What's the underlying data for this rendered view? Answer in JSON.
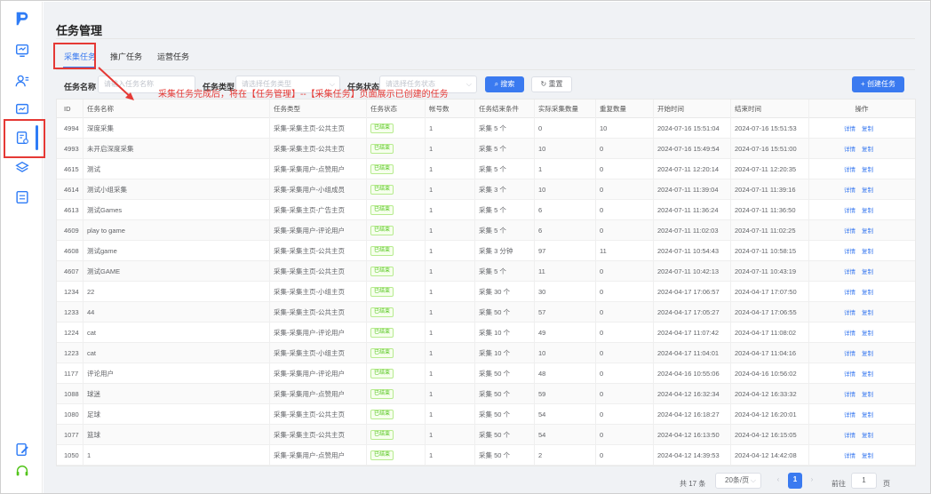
{
  "page_title": "任务管理",
  "tabs": [
    "采集任务",
    "推广任务",
    "运营任务"
  ],
  "filters": {
    "name_label": "任务名称",
    "name_placeholder": "请输入任务名称",
    "type_label": "任务类型",
    "type_placeholder": "请选择任务类型",
    "status_label": "任务状态",
    "status_placeholder": "请选择任务状态",
    "search_label": "搜索",
    "reset_label": "重置",
    "create_label": "+ 创建任务"
  },
  "annotation": "采集任务完成后，将在【任务管理】--【采集任务】页面展示已创建的任务",
  "columns": [
    "ID",
    "任务名称",
    "任务类型",
    "任务状态",
    "帐号数",
    "任务结束条件",
    "实际采集数量",
    "重复数量",
    "开始时间",
    "结束时间",
    "操作"
  ],
  "row_actions": [
    "详情",
    "复制"
  ],
  "rows": [
    [
      "4994",
      "深度采集",
      "采集-采集主页-公共主页",
      "已结束",
      "1",
      "采集 5 个",
      "0",
      "10",
      "2024-07-16 15:51:04",
      "2024-07-16 15:51:53"
    ],
    [
      "4993",
      "未开启深度采集",
      "采集-采集主页-公共主页",
      "已结束",
      "1",
      "采集 5 个",
      "10",
      "0",
      "2024-07-16 15:49:54",
      "2024-07-16 15:51:00"
    ],
    [
      "4615",
      "测试",
      "采集-采集用户-点赞用户",
      "已结束",
      "1",
      "采集 5 个",
      "1",
      "0",
      "2024-07-11 12:20:14",
      "2024-07-11 12:20:35"
    ],
    [
      "4614",
      "测试小组采集",
      "采集-采集用户-小组成员",
      "已结束",
      "1",
      "采集 3 个",
      "10",
      "0",
      "2024-07-11 11:39:04",
      "2024-07-11 11:39:16"
    ],
    [
      "4613",
      "测试Games",
      "采集-采集主页-广告主页",
      "已结束",
      "1",
      "采集 5 个",
      "6",
      "0",
      "2024-07-11 11:36:24",
      "2024-07-11 11:36:50"
    ],
    [
      "4609",
      "play to game",
      "采集-采集用户-评论用户",
      "已结束",
      "1",
      "采集 5 个",
      "6",
      "0",
      "2024-07-11 11:02:03",
      "2024-07-11 11:02:25"
    ],
    [
      "4608",
      "测试game",
      "采集-采集主页-公共主页",
      "已结束",
      "1",
      "采集 3 分钟",
      "97",
      "11",
      "2024-07-11 10:54:43",
      "2024-07-11 10:58:15"
    ],
    [
      "4607",
      "测试GAME",
      "采集-采集主页-公共主页",
      "已结束",
      "1",
      "采集 5 个",
      "11",
      "0",
      "2024-07-11 10:42:13",
      "2024-07-11 10:43:19"
    ],
    [
      "1234",
      "22",
      "采集-采集主页-小组主页",
      "已结束",
      "1",
      "采集 30 个",
      "30",
      "0",
      "2024-04-17 17:06:57",
      "2024-04-17 17:07:50"
    ],
    [
      "1233",
      "44",
      "采集-采集主页-公共主页",
      "已结束",
      "1",
      "采集 50 个",
      "57",
      "0",
      "2024-04-17 17:05:27",
      "2024-04-17 17:06:55"
    ],
    [
      "1224",
      "cat",
      "采集-采集用户-评论用户",
      "已结束",
      "1",
      "采集 10 个",
      "49",
      "0",
      "2024-04-17 11:07:42",
      "2024-04-17 11:08:02"
    ],
    [
      "1223",
      "cat",
      "采集-采集主页-小组主页",
      "已结束",
      "1",
      "采集 10 个",
      "10",
      "0",
      "2024-04-17 11:04:01",
      "2024-04-17 11:04:16"
    ],
    [
      "1177",
      "评论用户",
      "采集-采集用户-评论用户",
      "已结束",
      "1",
      "采集 50 个",
      "48",
      "0",
      "2024-04-16 10:55:06",
      "2024-04-16 10:56:02"
    ],
    [
      "1088",
      "球迷",
      "采集-采集用户-点赞用户",
      "已结束",
      "1",
      "采集 50 个",
      "59",
      "0",
      "2024-04-12 16:32:34",
      "2024-04-12 16:33:32"
    ],
    [
      "1080",
      "足球",
      "采集-采集主页-公共主页",
      "已结束",
      "1",
      "采集 50 个",
      "54",
      "0",
      "2024-04-12 16:18:27",
      "2024-04-12 16:20:01"
    ],
    [
      "1077",
      "篮球",
      "采集-采集主页-公共主页",
      "已结束",
      "1",
      "采集 50 个",
      "54",
      "0",
      "2024-04-12 16:13:50",
      "2024-04-12 16:15:05"
    ],
    [
      "1050",
      "1",
      "采集-采集用户-点赞用户",
      "已结束",
      "1",
      "采集 50 个",
      "2",
      "0",
      "2024-04-12 14:39:53",
      "2024-04-12 14:42:08"
    ]
  ],
  "pagination": {
    "total": "共 17 条",
    "page_size": "20条/页",
    "current": "1",
    "goto_label": "前往",
    "goto_value": "1",
    "page_unit": "页"
  },
  "sidebar_icons": [
    "app-logo-icon",
    "dashboard-icon",
    "users-icon",
    "monitor-icon",
    "task-list-icon",
    "layers-icon",
    "document-icon",
    "edit-icon",
    "headset-icon"
  ],
  "colors": {
    "accent": "#3a7af0",
    "highlight": "#e53935",
    "status_green": "#52c41a"
  }
}
